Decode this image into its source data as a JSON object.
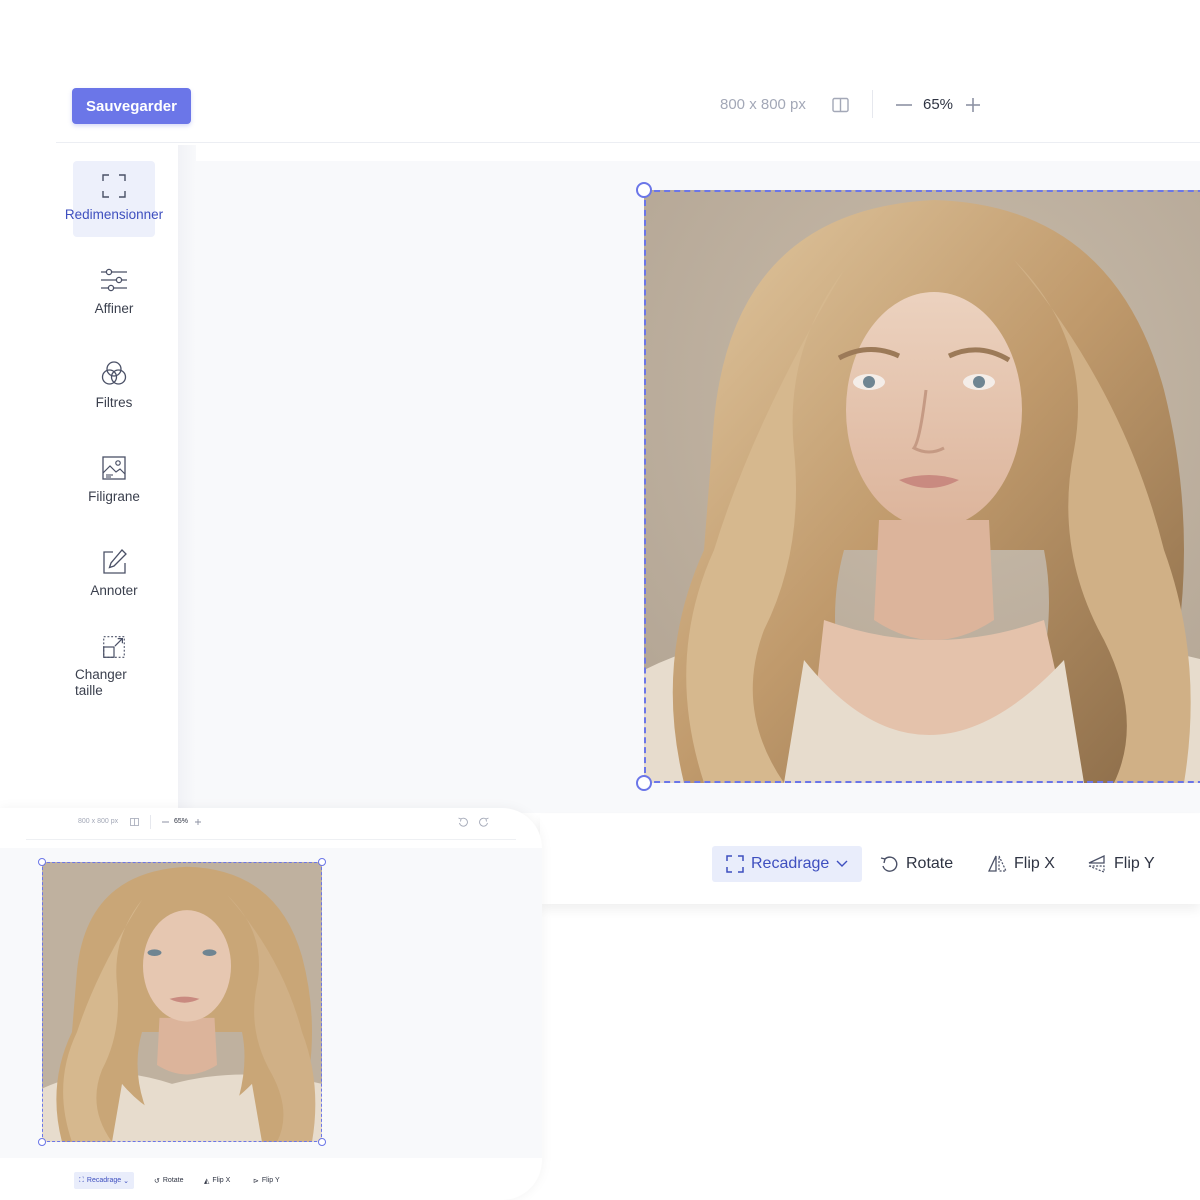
{
  "toolbar": {
    "save_label": "Sauvegarder",
    "dimensions": "800 x 800 px",
    "zoom": "65%"
  },
  "sidebar": {
    "items": [
      {
        "label": "Redimensionner",
        "icon": "crop-frame-icon",
        "active": true
      },
      {
        "label": "Affiner",
        "icon": "sliders-icon"
      },
      {
        "label": "Filtres",
        "icon": "filters-icon"
      },
      {
        "label": "Filigrane",
        "icon": "watermark-image-icon"
      },
      {
        "label": "Annoter",
        "icon": "edit-pencil-icon"
      },
      {
        "label": "Changer taille",
        "icon": "resize-icon"
      }
    ]
  },
  "bottom_tools": [
    {
      "label": "Recadrage",
      "icon": "crop-icon",
      "active": true
    },
    {
      "label": "Rotate",
      "icon": "rotate-icon"
    },
    {
      "label": "Flip X",
      "icon": "flip-x-icon"
    },
    {
      "label": "Flip Y",
      "icon": "flip-y-icon"
    }
  ],
  "preview": {
    "dimensions": "800 x 800 px",
    "zoom": "65%",
    "tools": [
      "Recadrage",
      "Rotate",
      "Flip X",
      "Flip Y"
    ]
  },
  "colors": {
    "accent": "#6b76e8",
    "active_bg": "#edf0fb",
    "active_text": "#3e4fbf",
    "canvas_bg": "#f8f9fb"
  }
}
